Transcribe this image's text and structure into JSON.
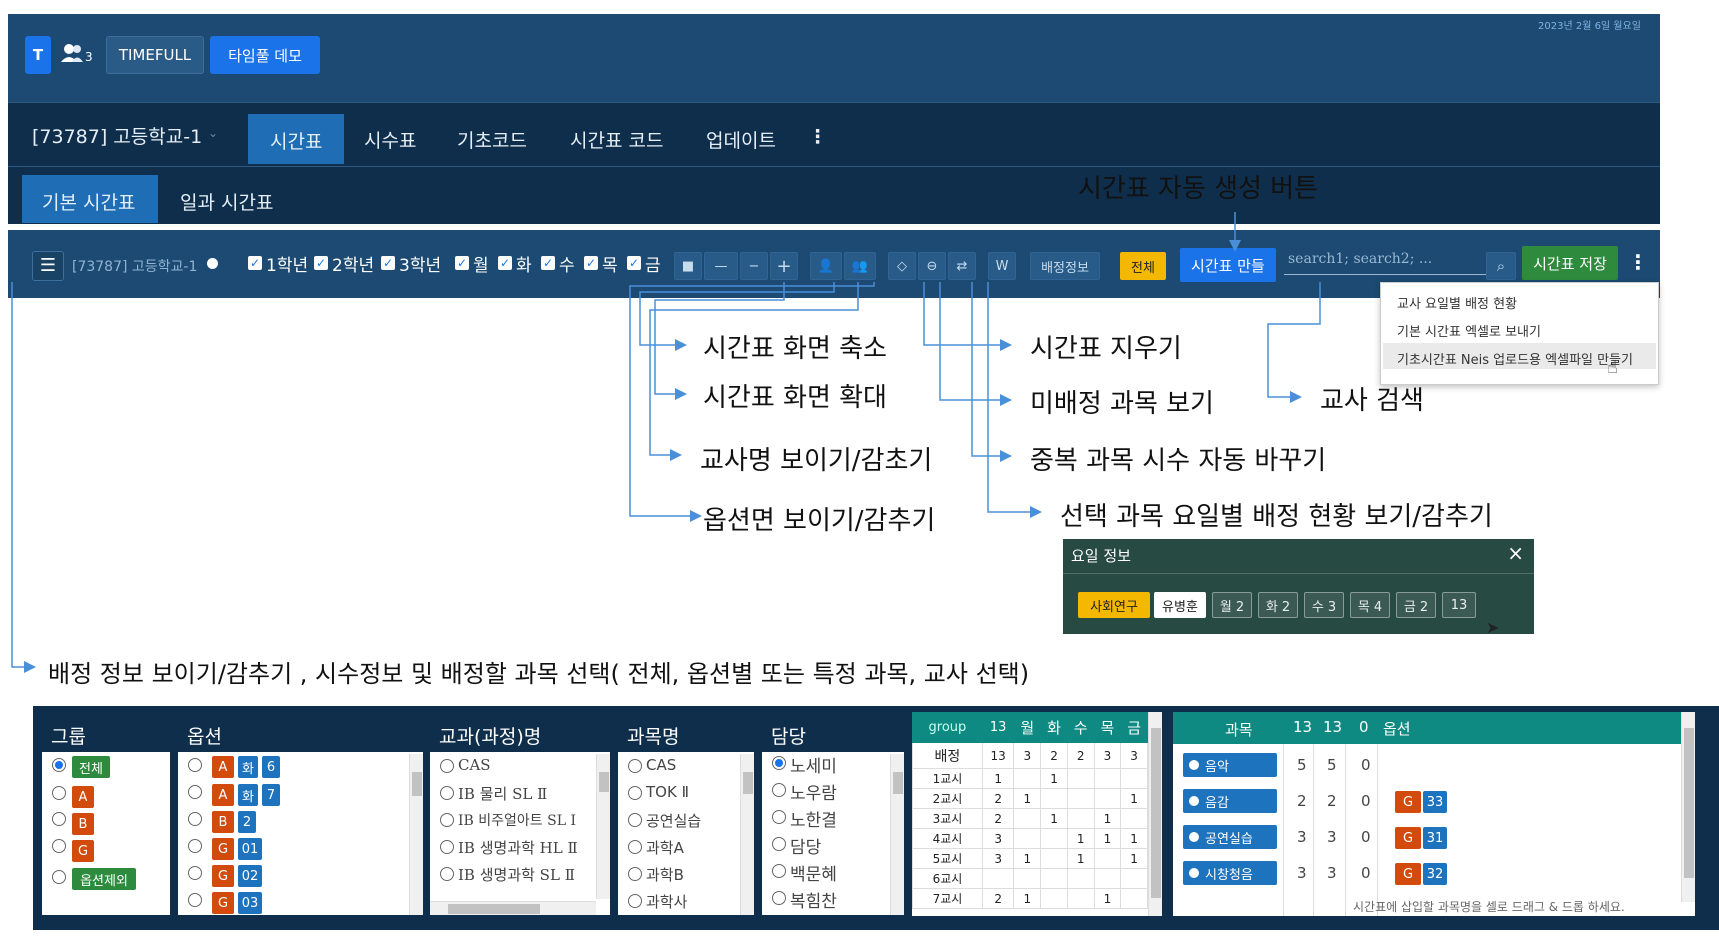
{
  "date_text": "2023년 2월 6일 월요일",
  "header": {
    "t_logo": "T",
    "user_count": "3",
    "timefull_label": "TIMEFULL",
    "demo_label": "타임풀 데모"
  },
  "nav": {
    "school": "[73787] 고등학교-1",
    "tabs": [
      "시간표",
      "시수표",
      "기초코드",
      "시간표 코드",
      "업데이트"
    ],
    "subtabs": [
      "기본 시간표",
      "일과 시간표"
    ]
  },
  "toolbar": {
    "school_label": "[73787] 고등학교-1",
    "grades": [
      "1학년",
      "2학년",
      "3학년"
    ],
    "days": [
      "월",
      "화",
      "수",
      "목",
      "금"
    ],
    "w_label": "W",
    "assign_info_label": "배정정보",
    "all_label": "전체",
    "auto_gen_label": "시간표 만들",
    "search_placeholder": "search1; search2; ...",
    "save_label": "시간표 저장"
  },
  "dropdown": {
    "items": [
      "교사 요일별 배정 현황",
      "기본 시간표 엑셀로 보내기",
      "기초시간표 Neis 업로드용 엑셀파일 만들기"
    ]
  },
  "annotations": {
    "auto_gen": "시간표 자동 생성 버튼",
    "zoom_out": "시간표 화면 축소",
    "zoom_in": "시간표 화면 확대",
    "teacher_name": "교사명 보이기/감초기",
    "option_view": "옵션면 보이기/감추기",
    "erase": "시간표 지우기",
    "unassigned": "미배정 과목 보기",
    "dup_swap": "중복 과목 시수 자동 바꾸기",
    "elective_view": "선택 과목 요일별 배정 현황 보기/감추기",
    "teacher_search": "교사 검색",
    "assign_info": "배정 정보 보이기/감추기 , 시수정보  및 배정할 과목 선택( 전체, 옵션별 또는 특정 과목, 교사 선택)"
  },
  "day_info": {
    "title": "요일 정보",
    "close": "×",
    "subject": "사회연구",
    "teacher": "유병훈",
    "days": [
      "월 2",
      "화 2",
      "수 3",
      "목 4",
      "금 2"
    ],
    "total": "13"
  },
  "panel": {
    "group": {
      "header": "그룹",
      "items": [
        "전체",
        "A",
        "B",
        "G",
        "옵션제외"
      ]
    },
    "option": {
      "header": "옵션",
      "rows": [
        {
          "g": "A",
          "s": "화",
          "n": "6"
        },
        {
          "g": "A",
          "s": "화",
          "n": "7"
        },
        {
          "g": "B",
          "s": "",
          "n": "2"
        },
        {
          "g": "G",
          "s": "",
          "n": "01"
        },
        {
          "g": "G",
          "s": "",
          "n": "02"
        },
        {
          "g": "G",
          "s": "",
          "n": "03"
        }
      ]
    },
    "course": {
      "header": "교과(과정)명",
      "items": [
        "CAS",
        "IB 물리 SL Ⅱ",
        "IB 비주얼아트 SL Ⅰ",
        "IB 생명과학 HL Ⅱ",
        "IB 생명과학 SL Ⅱ"
      ]
    },
    "subject": {
      "header": "과목명",
      "items": [
        "CAS",
        "TOK Ⅱ",
        "공연실습",
        "과학A",
        "과학B",
        "과학사"
      ]
    },
    "teacher": {
      "header": "담당",
      "items": [
        "노세미",
        "노우람",
        "노한결",
        "담당",
        "백문혜",
        "복힘찬"
      ]
    },
    "periods": {
      "header": [
        "group",
        "13",
        "월",
        "화",
        "수",
        "목",
        "금"
      ],
      "rows": [
        [
          "배정",
          "13",
          "3",
          "2",
          "2",
          "3",
          "3"
        ],
        [
          "1교시",
          "1",
          "",
          "1",
          "",
          "",
          ""
        ],
        [
          "2교시",
          "2",
          "1",
          "",
          "",
          "",
          "1"
        ],
        [
          "3교시",
          "2",
          "",
          "1",
          "",
          "1",
          ""
        ],
        [
          "4교시",
          "3",
          "",
          "",
          "1",
          "1",
          "1"
        ],
        [
          "5교시",
          "3",
          "1",
          "",
          "1",
          "",
          "1"
        ],
        [
          "6교시",
          "",
          "",
          "",
          "",
          "",
          ""
        ],
        [
          "7교시",
          "2",
          "1",
          "",
          "",
          "1",
          ""
        ]
      ]
    },
    "subjects": {
      "header": [
        "과목",
        "13",
        "13",
        "0",
        "옵션"
      ],
      "rows": [
        {
          "name": "음악",
          "a": "5",
          "b": "5",
          "c": "0",
          "g": "",
          "n": ""
        },
        {
          "name": "음감",
          "a": "2",
          "b": "2",
          "c": "0",
          "g": "G",
          "n": "33"
        },
        {
          "name": "공연실습",
          "a": "3",
          "b": "3",
          "c": "0",
          "g": "G",
          "n": "31"
        },
        {
          "name": "시창청음",
          "a": "3",
          "b": "3",
          "c": "0",
          "g": "G",
          "n": "32"
        }
      ],
      "footer": "시간표에 삽입할 과목명을 셀로 드래그 & 드롭 하세요."
    }
  },
  "colors": {
    "topbar": "#1c4a72",
    "nav": "#0f2e4b",
    "accent_blue": "#1a73e8",
    "green": "#2e8b3e",
    "orange": "#d24a0c",
    "yellow": "#f5b800",
    "teal": "#0f8a83"
  }
}
